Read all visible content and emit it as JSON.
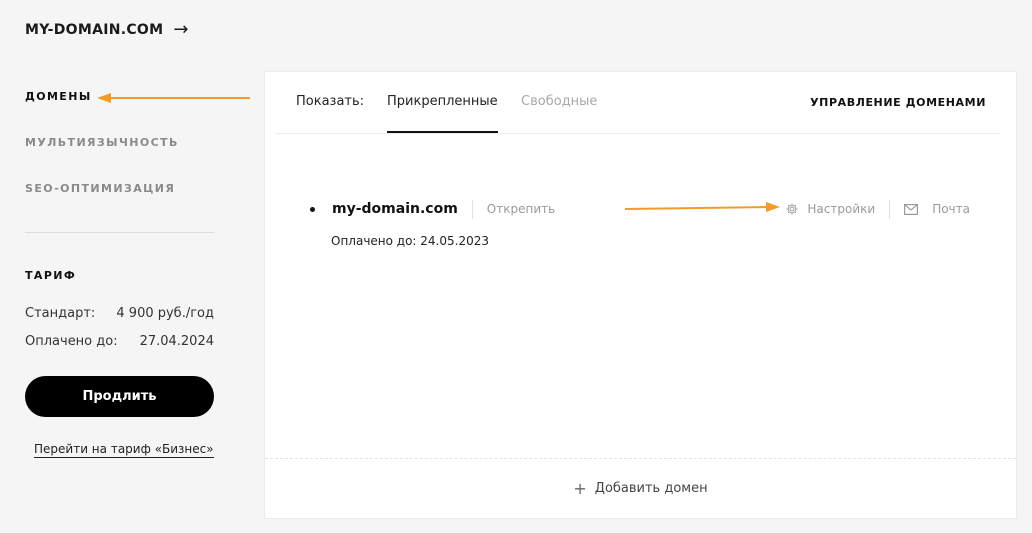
{
  "header": {
    "site_title": "MY-DOMAIN.COM",
    "arrow_icon": "→"
  },
  "sidebar": {
    "nav": [
      {
        "label": "ДОМЕНЫ",
        "active": true
      },
      {
        "label": "МУЛЬТИЯЗЫЧНОСТЬ",
        "active": false
      },
      {
        "label": "SEO-ОПТИМИЗАЦИЯ",
        "active": false
      }
    ],
    "tariff": {
      "heading": "ТАРИФ",
      "plan_label": "Стандарт:",
      "plan_price": "4 900 руб./год",
      "paid_label": "Оплачено до:",
      "paid_date": "27.04.2024",
      "renew_button": "Продлить",
      "switch_link": "Перейти на тариф «Бизнес»"
    }
  },
  "main": {
    "tabs": {
      "show_label": "Показать:",
      "pinned": "Прикрепленные",
      "free": "Свободные"
    },
    "manage_link": "УПРАВЛЕНИЕ ДОМЕНАМИ",
    "domain": {
      "name": "my-domain.com",
      "unpin": "Открепить",
      "paid_until": "Оплачено до: 24.05.2023",
      "settings": "Настройки",
      "mail": "Почта"
    },
    "add_domain": "Добавить домен",
    "add_icon": "+"
  },
  "colors": {
    "accent_arrow": "#f29b2b",
    "button_bg": "#000000",
    "page_bg": "#f5f5f5"
  },
  "icons": [
    "arrow-right-icon",
    "gear-icon",
    "mail-icon",
    "plus-icon"
  ]
}
